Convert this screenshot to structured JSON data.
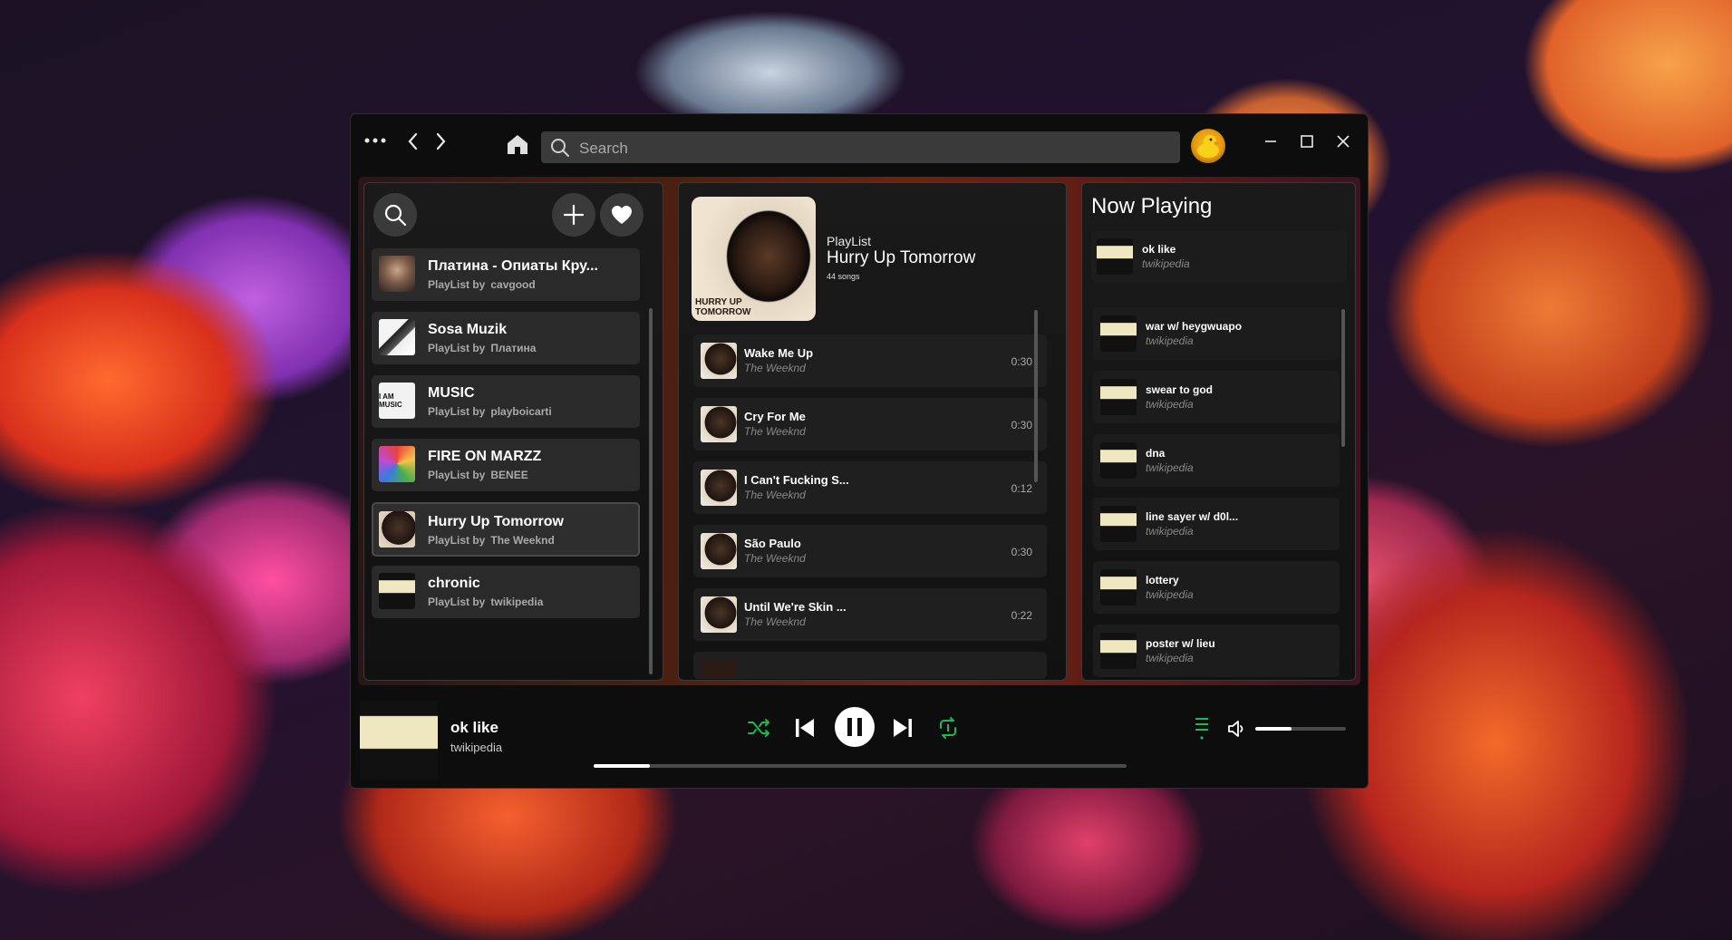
{
  "titlebar": {
    "search_placeholder": "Search",
    "icons": [
      "more-icon",
      "back-icon",
      "forward-icon",
      "home-icon",
      "search-icon",
      "avatar",
      "minimize-icon",
      "maximize-icon",
      "close-icon"
    ]
  },
  "sidebar": {
    "playlists": [
      {
        "title": "Платина - Опиаты Кру...",
        "by_label": "PlayList by",
        "author": "cavgood"
      },
      {
        "title": "Sosa Muzik",
        "by_label": "PlayList by",
        "author": "Платина"
      },
      {
        "title": "MUSIC",
        "by_label": "PlayList by",
        "author": "playboicarti"
      },
      {
        "title": "FIRE ON MARZZ",
        "by_label": "PlayList by",
        "author": "BENEE"
      },
      {
        "title": "Hurry Up Tomorrow",
        "by_label": "PlayList by",
        "author": "The Weeknd"
      },
      {
        "title": "chronic",
        "by_label": "PlayList by",
        "author": "twikipedia"
      }
    ]
  },
  "playlist_view": {
    "type_label": "PlayList",
    "title": "Hurry Up Tomorrow",
    "count": "44 songs",
    "cover_text": "HURRY UP TOMORROW",
    "tracks": [
      {
        "title": "Wake Me Up",
        "artist": "The Weeknd",
        "duration": "0:30"
      },
      {
        "title": "Cry For Me",
        "artist": "The Weeknd",
        "duration": "0:30"
      },
      {
        "title": "I Can't Fucking S...",
        "artist": "The Weeknd",
        "duration": "0:12"
      },
      {
        "title": "São Paulo",
        "artist": "The Weeknd",
        "duration": "0:30"
      },
      {
        "title": "Until We're Skin ...",
        "artist": "The Weeknd",
        "duration": "0:22"
      }
    ]
  },
  "now_playing": {
    "heading": "Now Playing",
    "current": {
      "title": "ok like",
      "artist": "twikipedia"
    },
    "queue": [
      {
        "title": "war w/ heygwuapo",
        "artist": "twikipedia"
      },
      {
        "title": "swear to god",
        "artist": "twikipedia"
      },
      {
        "title": "dna",
        "artist": "twikipedia"
      },
      {
        "title": "line sayer w/ d0l...",
        "artist": "twikipedia"
      },
      {
        "title": "lottery",
        "artist": "twikipedia"
      },
      {
        "title": "poster w/ lieu",
        "artist": "twikipedia"
      }
    ]
  },
  "player": {
    "title": "ok like",
    "artist": "twikipedia",
    "progress_fraction": 0.105,
    "volume_fraction": 0.4,
    "accent_color": "#1db954"
  }
}
